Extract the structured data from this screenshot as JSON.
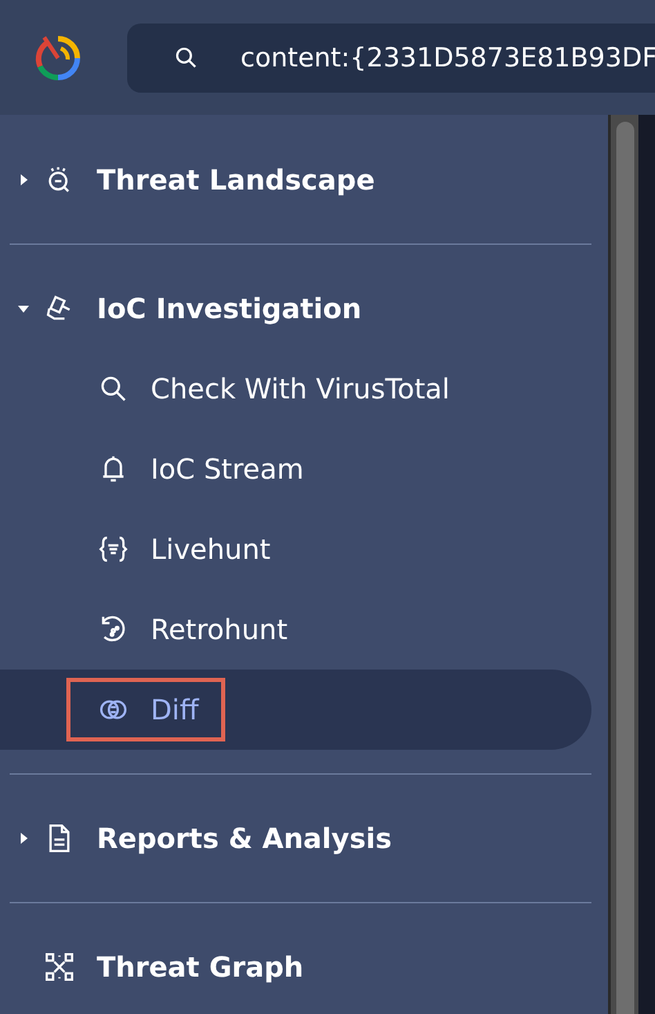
{
  "header": {
    "search": {
      "value": "content:{2331D5873E81B93DF"
    }
  },
  "nav": [
    {
      "kind": "section",
      "label": "Threat Landscape",
      "expanded": false
    },
    {
      "kind": "section",
      "label": "IoC Investigation",
      "expanded": true,
      "children": [
        {
          "label": "Check With VirusTotal",
          "selected": false,
          "highlighted": false
        },
        {
          "label": "IoC Stream",
          "selected": false,
          "highlighted": false
        },
        {
          "label": "Livehunt",
          "selected": false,
          "highlighted": false
        },
        {
          "label": "Retrohunt",
          "selected": false,
          "highlighted": false
        },
        {
          "label": "Diff",
          "selected": true,
          "highlighted": true
        }
      ]
    },
    {
      "kind": "section",
      "label": "Reports & Analysis",
      "expanded": false
    },
    {
      "kind": "link",
      "label": "Threat Graph"
    }
  ]
}
